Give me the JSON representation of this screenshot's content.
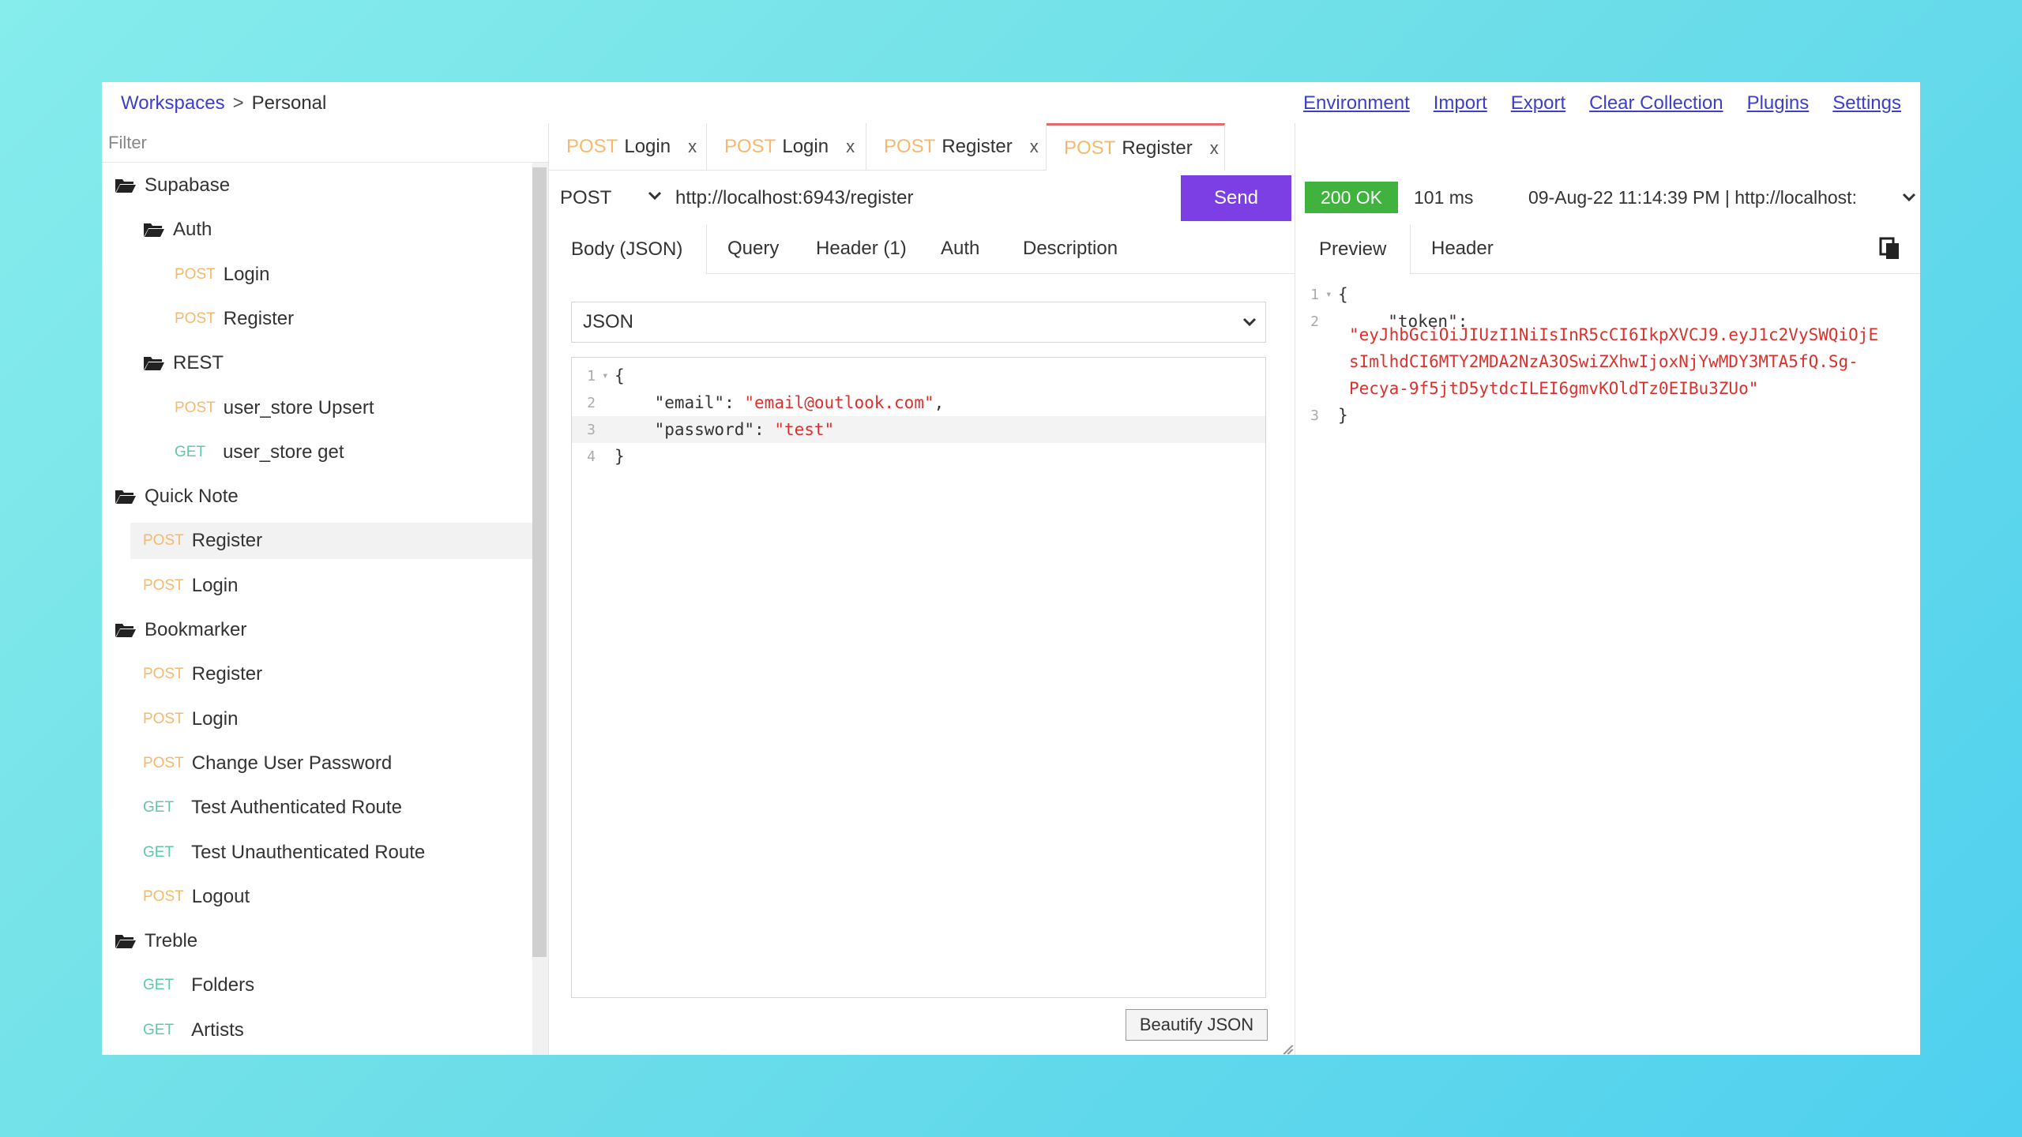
{
  "breadcrumb": {
    "workspaces": "Workspaces",
    "separator": ">",
    "current": "Personal"
  },
  "topnav": [
    "Environment",
    "Import",
    "Export",
    "Clear Collection",
    "Plugins",
    "Settings"
  ],
  "sidebar": {
    "filter_placeholder": "Filter",
    "tree": [
      {
        "type": "folder",
        "label": "Supabase"
      },
      {
        "type": "folder",
        "label": "Auth"
      },
      {
        "type": "request",
        "method": "POST",
        "label": "Login"
      },
      {
        "type": "request",
        "method": "POST",
        "label": "Register"
      },
      {
        "type": "folder",
        "label": "REST"
      },
      {
        "type": "request",
        "method": "POST",
        "label": "user_store Upsert"
      },
      {
        "type": "request",
        "method": "GET",
        "label": "user_store get"
      },
      {
        "type": "folder",
        "label": "Quick Note"
      },
      {
        "type": "request",
        "method": "POST",
        "label": "Register",
        "selected": true
      },
      {
        "type": "request",
        "method": "POST",
        "label": "Login"
      },
      {
        "type": "folder",
        "label": "Bookmarker"
      },
      {
        "type": "request",
        "method": "POST",
        "label": "Register"
      },
      {
        "type": "request",
        "method": "POST",
        "label": "Login"
      },
      {
        "type": "request",
        "method": "POST",
        "label": "Change User Password"
      },
      {
        "type": "request",
        "method": "GET",
        "label": "Test Authenticated Route"
      },
      {
        "type": "request",
        "method": "GET",
        "label": "Test Unauthenticated Route"
      },
      {
        "type": "request",
        "method": "POST",
        "label": "Logout"
      },
      {
        "type": "folder",
        "label": "Treble"
      },
      {
        "type": "request",
        "method": "GET",
        "label": "Folders"
      },
      {
        "type": "request",
        "method": "GET",
        "label": "Artists"
      }
    ]
  },
  "tabs": [
    {
      "method": "POST",
      "label": "Login",
      "close": "x"
    },
    {
      "method": "POST",
      "label": "Login",
      "close": "x"
    },
    {
      "method": "POST",
      "label": "Register",
      "close": "x"
    },
    {
      "method": "POST",
      "label": "Register",
      "close": "x",
      "active": true
    }
  ],
  "request": {
    "method": "POST",
    "url": "http://localhost:6943/register",
    "send_label": "Send",
    "tabs": [
      "Body (JSON)",
      "Query",
      "Header (1)",
      "Auth",
      "Description"
    ],
    "body_type": "JSON",
    "beautify_label": "Beautify JSON",
    "body_lines": [
      "1",
      "2",
      "3",
      "4"
    ],
    "body": {
      "open": "{",
      "email_key": "\"email\"",
      "email_value": "\"email@outlook.com\"",
      "password_key": "\"password\"",
      "password_value": "\"test\"",
      "close": "}"
    }
  },
  "response": {
    "status": "200 OK",
    "time": "101 ms",
    "history": "09-Aug-22 11:14:39 PM | http://localhost:",
    "tabs": [
      "Preview",
      "Header"
    ],
    "lines": [
      "1",
      "2",
      "3"
    ],
    "open": "{",
    "token_key": "\"token\":",
    "token_value_lines": [
      "\"eyJhbGciOiJIUzI1NiIsInR5cCI6IkpXVCJ9.eyJ1c2VySWQiOjE",
      "sImlhdCI6MTY2MDA2NzA3OSwiZXhwIjoxNjYwMDY3MTA5fQ.Sg-",
      "Pecya-9f5jtD5ytdcILEI6gmvKOldTz0EIBu3ZUo\""
    ],
    "close": "}"
  },
  "colors": {
    "post": "#f5b96b",
    "get": "#5fc9a3",
    "send": "#7b3fe4",
    "status_ok": "#40b33f",
    "link": "#3b3fc9",
    "string": "#d9322e"
  }
}
